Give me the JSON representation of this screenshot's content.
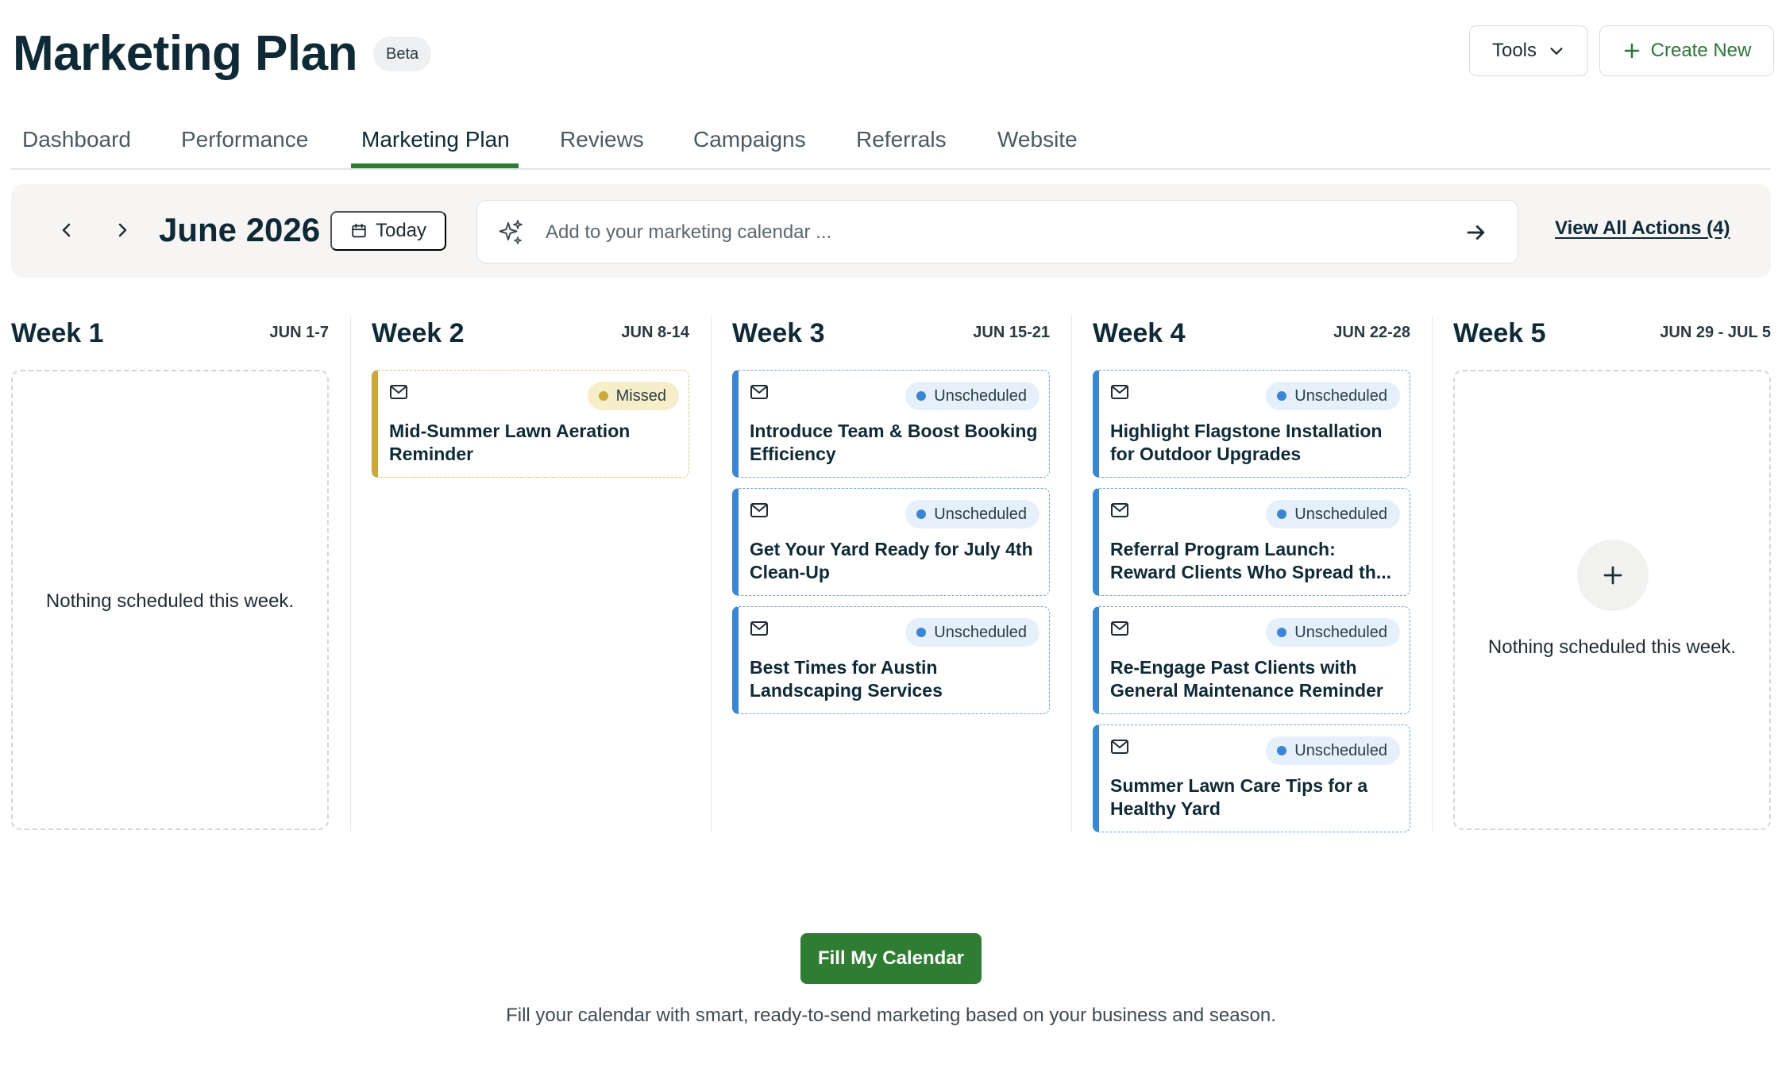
{
  "header": {
    "title": "Marketing Plan",
    "badge": "Beta",
    "tools_label": "Tools",
    "create_label": "Create New"
  },
  "tabs": [
    {
      "label": "Dashboard",
      "active": false
    },
    {
      "label": "Performance",
      "active": false
    },
    {
      "label": "Marketing Plan",
      "active": true
    },
    {
      "label": "Reviews",
      "active": false
    },
    {
      "label": "Campaigns",
      "active": false
    },
    {
      "label": "Referrals",
      "active": false
    },
    {
      "label": "Website",
      "active": false
    }
  ],
  "toolbar": {
    "month": "June 2026",
    "today_label": "Today",
    "input_placeholder": "Add to your marketing calendar ...",
    "view_all_label": "View All Actions (4)"
  },
  "weeks": [
    {
      "title": "Week 1",
      "range": "JUN 1-7",
      "empty_text": "Nothing scheduled this week.",
      "cards": []
    },
    {
      "title": "Week 2",
      "range": "JUN 8-14",
      "cards": [
        {
          "status": "Missed",
          "title": "Mid-Summer Lawn Aeration Reminder"
        }
      ]
    },
    {
      "title": "Week 3",
      "range": "JUN 15-21",
      "cards": [
        {
          "status": "Unscheduled",
          "title": "Introduce Team & Boost Booking Efficiency"
        },
        {
          "status": "Unscheduled",
          "title": "Get Your Yard Ready for July 4th Clean-Up"
        },
        {
          "status": "Unscheduled",
          "title": "Best Times for Austin Landscaping Services"
        }
      ]
    },
    {
      "title": "Week 4",
      "range": "JUN 22-28",
      "cards": [
        {
          "status": "Unscheduled",
          "title": "Highlight Flagstone Installation for Outdoor Upgrades"
        },
        {
          "status": "Unscheduled",
          "title": "Referral Program Launch: Reward Clients Who Spread th..."
        },
        {
          "status": "Unscheduled",
          "title": "Re-Engage Past Clients with General Maintenance Reminder"
        },
        {
          "status": "Unscheduled",
          "title": "Summer Lawn Care Tips for a Healthy Yard"
        }
      ]
    },
    {
      "title": "Week 5",
      "range": "JUN 29 - JUL 5",
      "empty_text": "Nothing scheduled this week.",
      "cards": []
    }
  ],
  "footer": {
    "fill_button": "Fill My Calendar",
    "description": "Fill your calendar with smart, ready-to-send marketing based on your business and season."
  },
  "icons": {
    "prev": "chevron-left-icon",
    "next": "chevron-right-icon",
    "today": "calendar-icon",
    "input": "sparkles-icon",
    "send": "arrow-right-icon",
    "card": "mail-icon",
    "add": "plus-icon"
  },
  "colors": {
    "brand_green": "#2e7d32",
    "unscheduled_blue": "#3a86d6",
    "missed_gold": "#c9a93a"
  }
}
